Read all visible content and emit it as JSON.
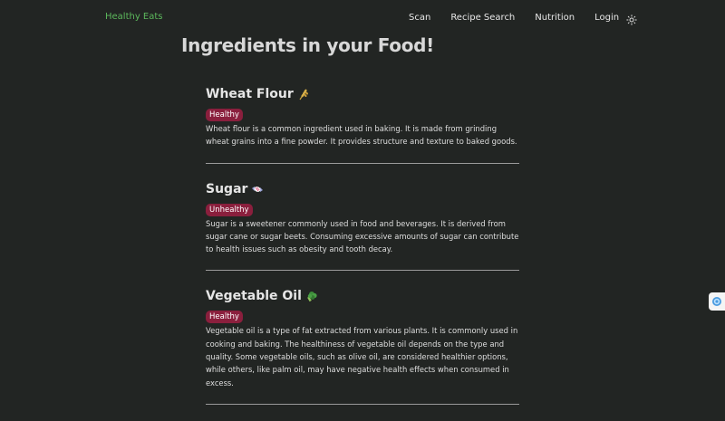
{
  "nav": {
    "brand": "Healthy Eats",
    "links": [
      "Scan",
      "Recipe Search",
      "Nutrition",
      "Login"
    ],
    "theme_icon": "sun-icon"
  },
  "page": {
    "title": "Ingredients in your Food!"
  },
  "ingredients": [
    {
      "name": "Wheat Flour",
      "emoji": "wheat-icon",
      "badge": "Healthy",
      "description": "Wheat flour is a common ingredient used in baking. It is made from grinding wheat grains into a fine powder. It provides structure and texture to baked goods."
    },
    {
      "name": "Sugar",
      "emoji": "candy-icon",
      "badge": "Unhealthy",
      "description": "Sugar is a sweetener commonly used in food and beverages. It is derived from sugar cane or sugar beets. Consuming excessive amounts of sugar can contribute to health issues such as obesity and tooth decay."
    },
    {
      "name": "Vegetable Oil",
      "emoji": "broccoli-icon",
      "badge": "Healthy",
      "description": "Vegetable oil is a type of fat extracted from various plants. It is commonly used in cooking and baking. The healthiness of vegetable oil depends on the type and quality. Some vegetable oils, such as olive oil, are considered healthier options, while others, like palm oil, may have negative health effects when consumed in excess."
    }
  ],
  "colors": {
    "background": "#222523",
    "brand": "#5cb85c",
    "badge": "#8a1f3d"
  }
}
